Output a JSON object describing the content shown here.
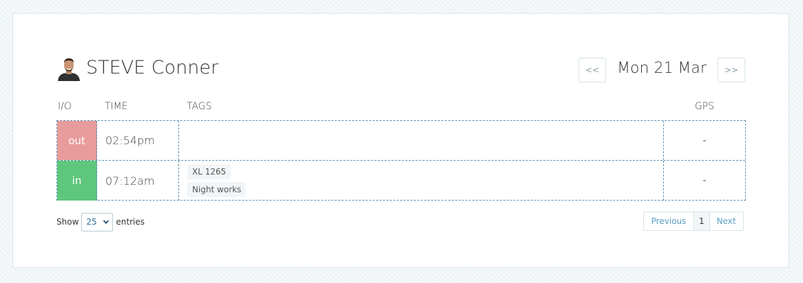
{
  "employee": {
    "name": "STEVE Conner"
  },
  "date_nav": {
    "prev_label": "<<",
    "date": "Mon 21 Mar",
    "next_label": ">>"
  },
  "table": {
    "headers": [
      "I/O",
      "TIME",
      "TAGS",
      "GPS"
    ],
    "rows": [
      {
        "io": "out",
        "time": "02:54pm",
        "tags": [],
        "gps": "-"
      },
      {
        "io": "in",
        "time": "07:12am",
        "tags": [
          "XL 1265",
          "Night works"
        ],
        "gps": "-"
      }
    ]
  },
  "length_menu": {
    "show": "Show",
    "value": "25",
    "entries": "entries"
  },
  "pagination": {
    "previous": "Previous",
    "current": "1",
    "next": "Next"
  },
  "colors": {
    "out": "#e89b9b",
    "in": "#5fc77d",
    "border": "#5b91b5",
    "link": "#5a9ec4"
  }
}
